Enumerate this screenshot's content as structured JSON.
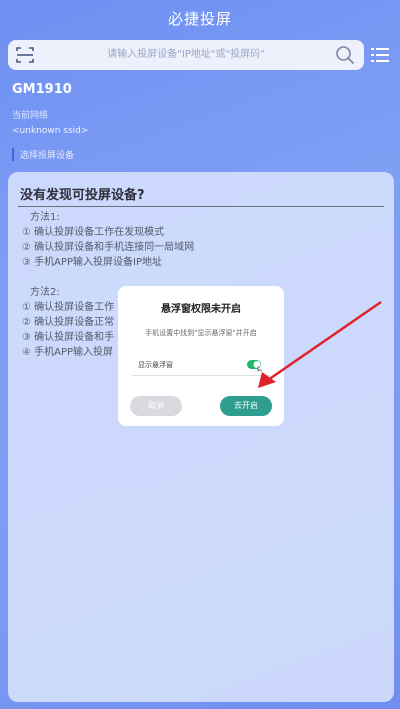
{
  "header": {
    "title": "必捷投屏"
  },
  "search": {
    "placeholder": "请输入投屏设备\"IP地址\"或\"投屏码\""
  },
  "device": {
    "name": "GM1910",
    "network_label": "当前网络",
    "ssid": "<unknown ssid>",
    "select_label": "选择投屏设备"
  },
  "card": {
    "title": "没有发现可投屏设备?",
    "method1": {
      "title": "方法1:",
      "steps": [
        "① 确认投屏设备工作在发现模式",
        "② 确认投屏设备和手机连接同一局域网",
        "③ 手机APP输入投屏设备IP地址"
      ]
    },
    "method2": {
      "title": "方法2:",
      "steps": [
        "① 确认投屏设备工作",
        "② 确认投屏设备正常",
        "③ 确认投屏设备和手",
        "④ 手机APP输入投屏"
      ]
    }
  },
  "dialog": {
    "title": "悬浮窗权限未开启",
    "description": "手机设置中找到\"显示悬浮窗\"并开启",
    "row_label": "显示悬浮窗",
    "cancel_label": "取消",
    "open_label": "去开启"
  },
  "colors": {
    "accent": "#2f9e8f",
    "arrow": "#e0202a",
    "toggle": "#1fb96a"
  }
}
